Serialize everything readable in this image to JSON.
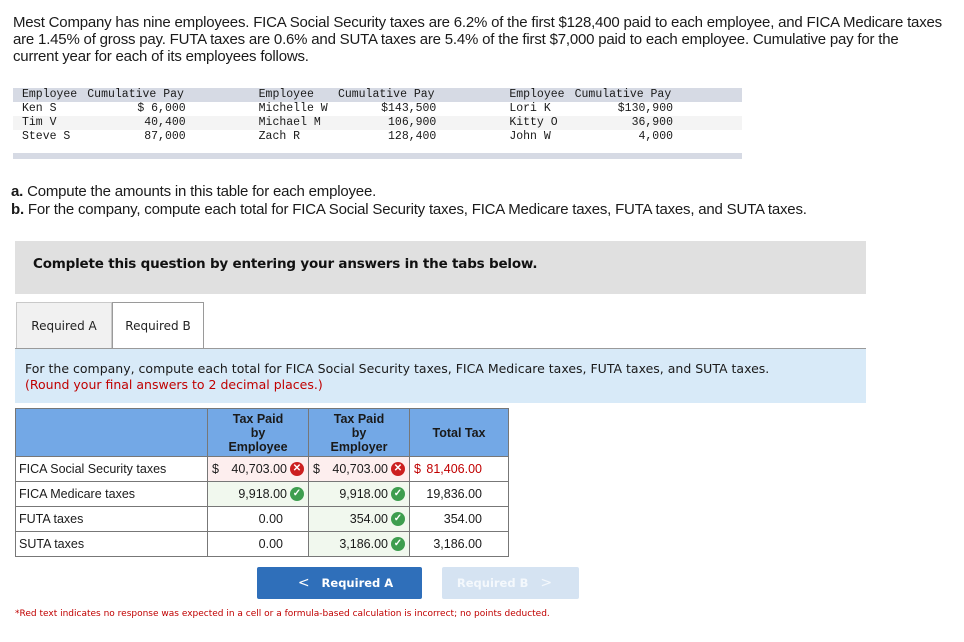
{
  "intro": "Mest Company has nine employees. FICA Social Security taxes are 6.2% of the first $128,400 paid to each employee, and FICA Medicare taxes are 1.45% of gross pay. FUTA taxes are 0.6% and SUTA taxes are 5.4% of the first $7,000 paid to each employee. Cumulative pay for the current year for each of its employees follows.",
  "employee_table": {
    "headers": [
      "Employee",
      "Cumulative Pay",
      "Employee",
      "Cumulative Pay",
      "Employee",
      "Cumulative Pay"
    ],
    "rows": [
      [
        "Ken S",
        "$ 6,000",
        "Michelle W",
        "$143,500",
        "Lori K",
        "$130,900"
      ],
      [
        "Tim V",
        "40,400",
        "Michael M",
        "106,900",
        "Kitty O",
        "36,900"
      ],
      [
        "Steve S",
        "87,000",
        "Zach R",
        "128,400",
        "John W",
        "4,000"
      ]
    ]
  },
  "parts": {
    "a_label": "a.",
    "a_text": " Compute the amounts in this table for each employee.",
    "b_label": "b.",
    "b_text": " For the company, compute each total for FICA Social Security taxes, FICA Medicare taxes, FUTA taxes, and SUTA taxes."
  },
  "banner": "Complete this question by entering your answers in the tabs below.",
  "tabs": [
    {
      "label": "Required A",
      "active": false
    },
    {
      "label": "Required B",
      "active": true
    }
  ],
  "instructions": {
    "line1": "For the company, compute each total for FICA Social Security taxes, FICA Medicare taxes, FUTA taxes, and SUTA taxes.",
    "line2": "(Round your final answers to 2 decimal places.)"
  },
  "tax_table": {
    "headers": [
      "",
      "Tax Paid by Employee",
      "Tax Paid by Employer",
      "Total Tax"
    ],
    "header_lines": {
      "employee": [
        "Tax Paid",
        "by",
        "Employee"
      ],
      "employer": [
        "Tax Paid",
        "by",
        "Employer"
      ],
      "total": "Total Tax"
    },
    "rows": [
      {
        "label": "FICA Social Security taxes",
        "employee": "40,703.00",
        "employee_currency": "$",
        "employee_status": "incorrect",
        "employer": "40,703.00",
        "employer_currency": "$",
        "employer_status": "incorrect",
        "total": "81,406.00",
        "total_currency": "$",
        "total_color": "#c00000"
      },
      {
        "label": "FICA Medicare taxes",
        "employee": "9,918.00",
        "employee_status": "correct",
        "employer": "9,918.00",
        "employer_status": "correct",
        "total": "19,836.00"
      },
      {
        "label": "FUTA taxes",
        "employee": "0.00",
        "employer": "354.00",
        "employer_status": "correct",
        "total": "354.00"
      },
      {
        "label": "SUTA taxes",
        "employee": "0.00",
        "employer": "3,186.00",
        "employer_status": "correct",
        "total": "3,186.00"
      }
    ]
  },
  "nav": {
    "prev_label": "Required A",
    "prev_icon": "<",
    "next_label": "Required B",
    "next_icon": ">",
    "next_disabled": true
  },
  "footnote": "*Red text indicates no response was expected in a cell or a formula-based calculation is incorrect; no points deducted.",
  "icons": {
    "incorrect": "✕",
    "correct": "✓"
  },
  "colors": {
    "header_blue": "#73a8e6",
    "error_red": "#cc2020",
    "success_green": "#3e9e4f",
    "button_blue": "#2f6fba"
  }
}
